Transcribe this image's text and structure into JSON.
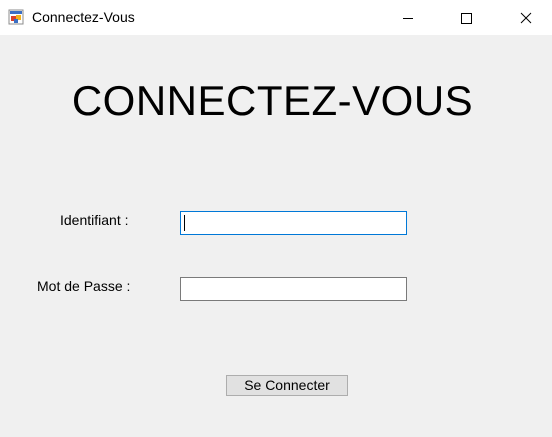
{
  "window": {
    "title": "Connectez-Vous"
  },
  "form": {
    "heading": "CONNECTEZ-VOUS",
    "identifiant_label": "Identifiant :",
    "identifiant_value": "",
    "password_label": "Mot de Passe :",
    "password_value": "",
    "submit_label": "Se Connecter"
  },
  "icons": {
    "app": "app-window-icon",
    "minimize": "minimize-icon",
    "maximize": "maximize-icon",
    "close": "close-icon"
  },
  "colors": {
    "focus_border": "#0078d7",
    "field_border": "#7a7a7a",
    "button_bg": "#e1e1e1",
    "button_border": "#adadad",
    "client_bg": "#f0f0f0"
  }
}
